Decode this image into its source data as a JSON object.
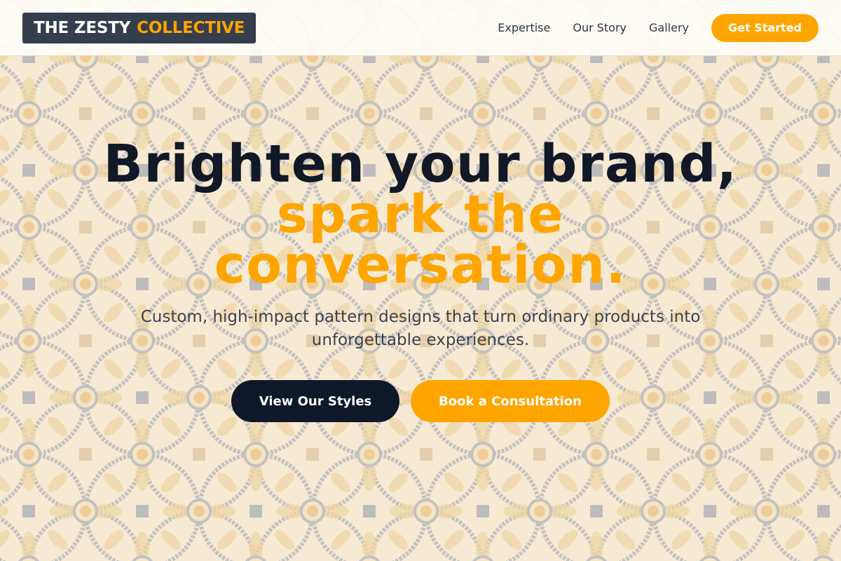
{
  "header": {
    "logo_part1": "THE ZESTY",
    "logo_part2": "COLLECTIVE",
    "nav": [
      {
        "label": "Expertise"
      },
      {
        "label": "Our Story"
      },
      {
        "label": "Gallery"
      }
    ],
    "cta_label": "Get Started"
  },
  "hero": {
    "headline_line1": "Brighten your brand,",
    "headline_accent": "spark the conversation.",
    "subline": "Custom, high-impact pattern designs that turn ordinary products into unforgettable experiences.",
    "primary_button": "View Our Styles",
    "secondary_button": "Book a Consultation"
  },
  "colors": {
    "accent": "#ffa500",
    "dark": "#0f172a",
    "logo_bg": "#353e4d",
    "background_tile": "#f4e7cf"
  }
}
